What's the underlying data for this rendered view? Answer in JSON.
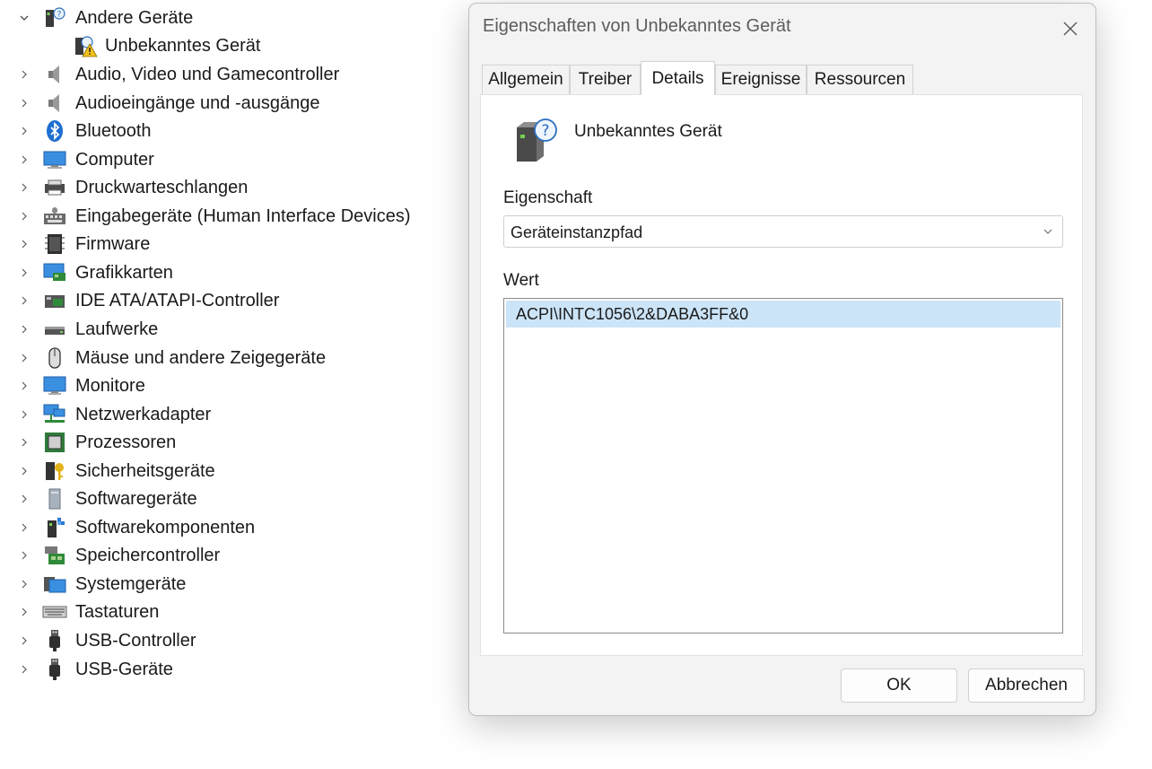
{
  "tree": {
    "expanded_category": "Andere Geräte",
    "child_item": "Unbekanntes Gerät",
    "categories": [
      {
        "label": "Audio, Video und Gamecontroller",
        "icon": "speaker-icon"
      },
      {
        "label": "Audioeingänge und -ausgänge",
        "icon": "speaker-icon"
      },
      {
        "label": "Bluetooth",
        "icon": "bluetooth-icon"
      },
      {
        "label": "Computer",
        "icon": "computer-icon"
      },
      {
        "label": "Druckwarteschlangen",
        "icon": "printer-icon"
      },
      {
        "label": "Eingabegeräte (Human Interface Devices)",
        "icon": "hid-icon"
      },
      {
        "label": "Firmware",
        "icon": "firmware-chip-icon"
      },
      {
        "label": "Grafikkarten",
        "icon": "display-adapter-icon"
      },
      {
        "label": "IDE ATA/ATAPI-Controller",
        "icon": "ide-controller-icon"
      },
      {
        "label": "Laufwerke",
        "icon": "disk-drive-icon"
      },
      {
        "label": "Mäuse und andere Zeigegeräte",
        "icon": "mouse-icon"
      },
      {
        "label": "Monitore",
        "icon": "monitor-icon"
      },
      {
        "label": "Netzwerkadapter",
        "icon": "network-adapter-icon"
      },
      {
        "label": "Prozessoren",
        "icon": "processor-icon"
      },
      {
        "label": "Sicherheitsgeräte",
        "icon": "security-key-icon"
      },
      {
        "label": "Softwaregeräte",
        "icon": "software-device-icon"
      },
      {
        "label": "Softwarekomponenten",
        "icon": "software-component-icon"
      },
      {
        "label": "Speichercontroller",
        "icon": "storage-controller-icon"
      },
      {
        "label": "Systemgeräte",
        "icon": "system-devices-icon"
      },
      {
        "label": "Tastaturen",
        "icon": "keyboard-icon"
      },
      {
        "label": "USB-Controller",
        "icon": "usb-icon"
      },
      {
        "label": "USB-Geräte",
        "icon": "usb-icon"
      }
    ]
  },
  "dialog": {
    "title": "Eigenschaften von Unbekanntes Gerät",
    "tabs": [
      "Allgemein",
      "Treiber",
      "Details",
      "Ereignisse",
      "Ressourcen"
    ],
    "active_tab": "Details",
    "device_name": "Unbekanntes Gerät",
    "property_label": "Eigenschaft",
    "property_selected": "Geräteinstanzpfad",
    "value_label": "Wert",
    "values": [
      "ACPI\\INTC1056\\2&DABA3FF&0"
    ],
    "ok_label": "OK",
    "cancel_label": "Abbrechen"
  },
  "colors": {
    "selection": "#cce4f7",
    "dialog_bg": "#f3f3f3",
    "panel_bg": "#ffffff",
    "title_text": "#5c5c5c"
  }
}
